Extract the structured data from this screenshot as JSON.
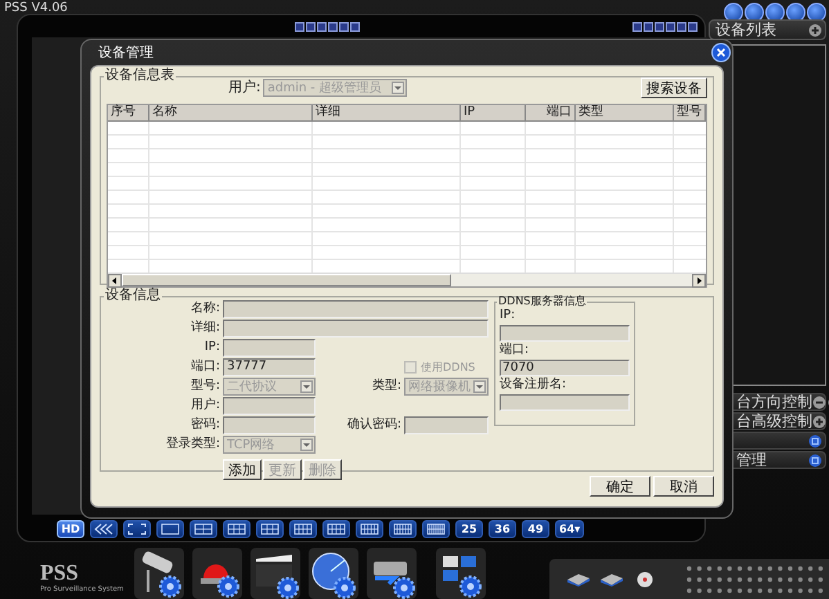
{
  "app": {
    "title": "PSS V4.06"
  },
  "sidebar": {
    "header": "设备列表",
    "panels": [
      {
        "label": "台方向控制",
        "kind": "ptz"
      },
      {
        "label": "台高级控制",
        "kind": "plus"
      },
      {
        "kind": "blue"
      },
      {
        "label": "管理",
        "kind": "blue"
      }
    ]
  },
  "layout_bar": [
    {
      "kind": "text",
      "label": "HD",
      "selected": true
    },
    {
      "kind": "back",
      "selected": false
    },
    {
      "kind": "full",
      "selected": false
    },
    {
      "kind": "split",
      "selected": false
    },
    {
      "kind": "split",
      "selected": false
    },
    {
      "kind": "split",
      "selected": false
    },
    {
      "kind": "split",
      "selected": false
    },
    {
      "kind": "split",
      "selected": false
    },
    {
      "kind": "split",
      "selected": false
    },
    {
      "kind": "split",
      "selected": false
    },
    {
      "kind": "split",
      "selected": false
    },
    {
      "kind": "split",
      "selected": false
    },
    {
      "kind": "text",
      "label": "25",
      "selected": false
    },
    {
      "kind": "text",
      "label": "36",
      "selected": false
    },
    {
      "kind": "text",
      "label": "49",
      "selected": false
    },
    {
      "kind": "text",
      "label": "64▾",
      "selected": false
    }
  ],
  "logo": {
    "name": "PSS",
    "subtitle": "Pro Surveillance System"
  },
  "dialog": {
    "title": "设备管理",
    "list_group": {
      "title": "设备信息表",
      "user_label": "用户:",
      "user_value": "admin - 超级管理员",
      "search_button": "搜索设备",
      "columns": [
        "序号",
        "名称",
        "详细",
        "IP",
        "端口",
        "类型",
        "型号"
      ]
    },
    "info_group": {
      "title": "设备信息",
      "name_label": "名称:",
      "detail_label": "详细:",
      "ip_label": "IP:",
      "port_label": "端口:",
      "port_value": "37777",
      "model_label": "型号:",
      "model_value": "二代协议",
      "user_label": "用户:",
      "password_label": "密码:",
      "login_label": "登录类型:",
      "login_value": "TCP网络",
      "ddns_checkbox": {
        "label": "使用DDNS",
        "checked": false,
        "disabled": true
      },
      "type_label": "类型:",
      "type_value": "网络摄像机",
      "confirm_label": "确认密码:",
      "buttons": [
        {
          "label": "添加",
          "disabled": false
        },
        {
          "label": "更新",
          "disabled": true
        },
        {
          "label": "删除",
          "disabled": true
        }
      ],
      "ddns": {
        "title": "DDNS服务器信息",
        "ip_label": "IP:",
        "port_label": "端口:",
        "port_value": "7070",
        "reg_label": "设备注册名:"
      }
    },
    "buttons": [
      "确定",
      "取消"
    ]
  }
}
